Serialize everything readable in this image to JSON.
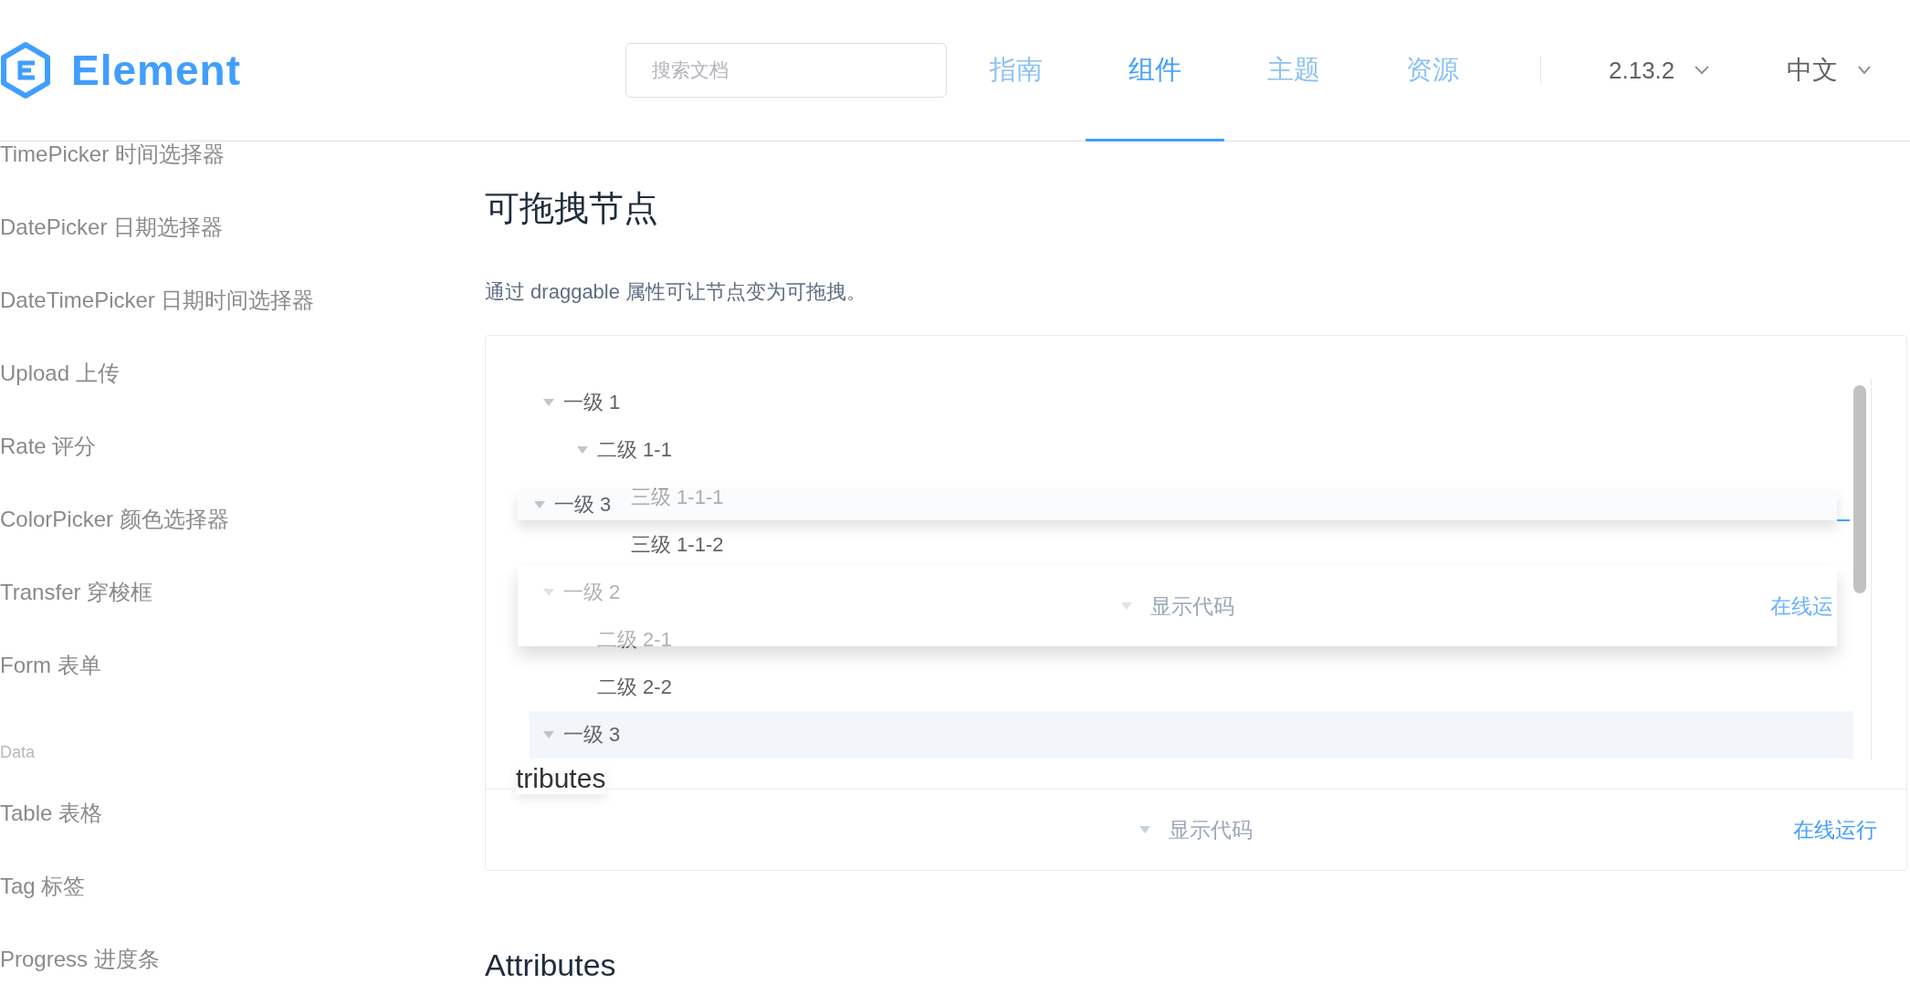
{
  "header": {
    "logo": "Element",
    "search": {
      "placeholder": "搜索文档"
    },
    "nav": [
      {
        "label": "指南",
        "selected": false
      },
      {
        "label": "组件",
        "selected": true
      },
      {
        "label": "主题",
        "selected": false
      },
      {
        "label": "资源",
        "selected": false
      }
    ],
    "version": "2.13.2",
    "language": "中文"
  },
  "sidebar": {
    "items": [
      {
        "kind": "item",
        "label": "TimePicker 时间选择器"
      },
      {
        "kind": "item",
        "label": "DatePicker 日期选择器"
      },
      {
        "kind": "item",
        "label": "DateTimePicker 日期时间选择器"
      },
      {
        "kind": "item",
        "label": "Upload 上传"
      },
      {
        "kind": "item",
        "label": "Rate 评分"
      },
      {
        "kind": "item",
        "label": "ColorPicker 颜色选择器"
      },
      {
        "kind": "item",
        "label": "Transfer 穿梭框"
      },
      {
        "kind": "item",
        "label": "Form 表单"
      },
      {
        "kind": "group",
        "label": "Data"
      },
      {
        "kind": "item",
        "label": "Table 表格"
      },
      {
        "kind": "item",
        "label": "Tag 标签"
      },
      {
        "kind": "item",
        "label": "Progress 进度条"
      }
    ]
  },
  "content": {
    "title": "可拖拽节点",
    "description": "通过 draggable 属性可让节点变为可拖拽。",
    "tree": [
      {
        "label": "一级 1",
        "expanded": true,
        "selected": false,
        "children": [
          {
            "label": "二级 1-1",
            "expanded": true,
            "selected": false,
            "children": [
              {
                "label": "三级 1-1-1",
                "selected": false
              },
              {
                "label": "三级 1-1-2",
                "selected": false
              }
            ]
          }
        ]
      },
      {
        "label": "一级 2",
        "expanded": true,
        "selected": false,
        "children": [
          {
            "label": "二级 2-1",
            "selected": false
          },
          {
            "label": "二级 2-2",
            "selected": false
          }
        ]
      },
      {
        "label": "一级 3",
        "expanded": true,
        "selected": true
      }
    ],
    "demo_controls": {
      "show_code": "显示代码",
      "run_online": "在线运行"
    },
    "next_heading": "Attributes"
  },
  "drag_ghosts": [
    {
      "kind": "node",
      "label": "一级 3"
    },
    {
      "kind": "controls",
      "show_code": "显示代码",
      "run_online": "在线运"
    },
    {
      "kind": "heading",
      "text": "tributes"
    }
  ]
}
